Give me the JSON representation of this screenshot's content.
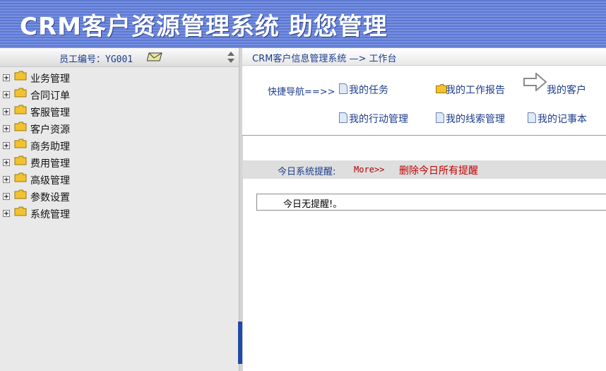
{
  "header": {
    "title": "CRM客户资源管理系统  助您管理"
  },
  "sidebar": {
    "employee_label": "员工编号：YG001",
    "items": [
      {
        "label": "业务管理"
      },
      {
        "label": "合同订单"
      },
      {
        "label": "客服管理"
      },
      {
        "label": "客户资源"
      },
      {
        "label": "商务助理"
      },
      {
        "label": "费用管理"
      },
      {
        "label": "高级管理"
      },
      {
        "label": "参数设置"
      },
      {
        "label": "系统管理"
      }
    ]
  },
  "main": {
    "breadcrumb": "CRM客户信息管理系统 —> 工作台",
    "quick_nav": {
      "label": "快捷导航==>>",
      "links": [
        {
          "label": "我的任务",
          "icon": "document-icon"
        },
        {
          "label": "我的工作报告",
          "icon": "folder-icon"
        },
        {
          "label": "我的客户",
          "icon": "arrow-right-icon"
        },
        {
          "label": "我的行动管理",
          "icon": "document-icon"
        },
        {
          "label": "我的线索管理",
          "icon": "document-icon"
        },
        {
          "label": "我的记事本",
          "icon": "document-icon"
        }
      ]
    },
    "reminder": {
      "label": "今日系统提醒:",
      "more": "More>>",
      "delete_all": "删除今日所有提醒",
      "empty_text": "今日无提醒!。"
    }
  },
  "colors": {
    "header_blue": "#5b78d4",
    "link_blue": "#1c3c8c",
    "alert_red": "#c00000",
    "folder_yellow": "#f2c230"
  }
}
